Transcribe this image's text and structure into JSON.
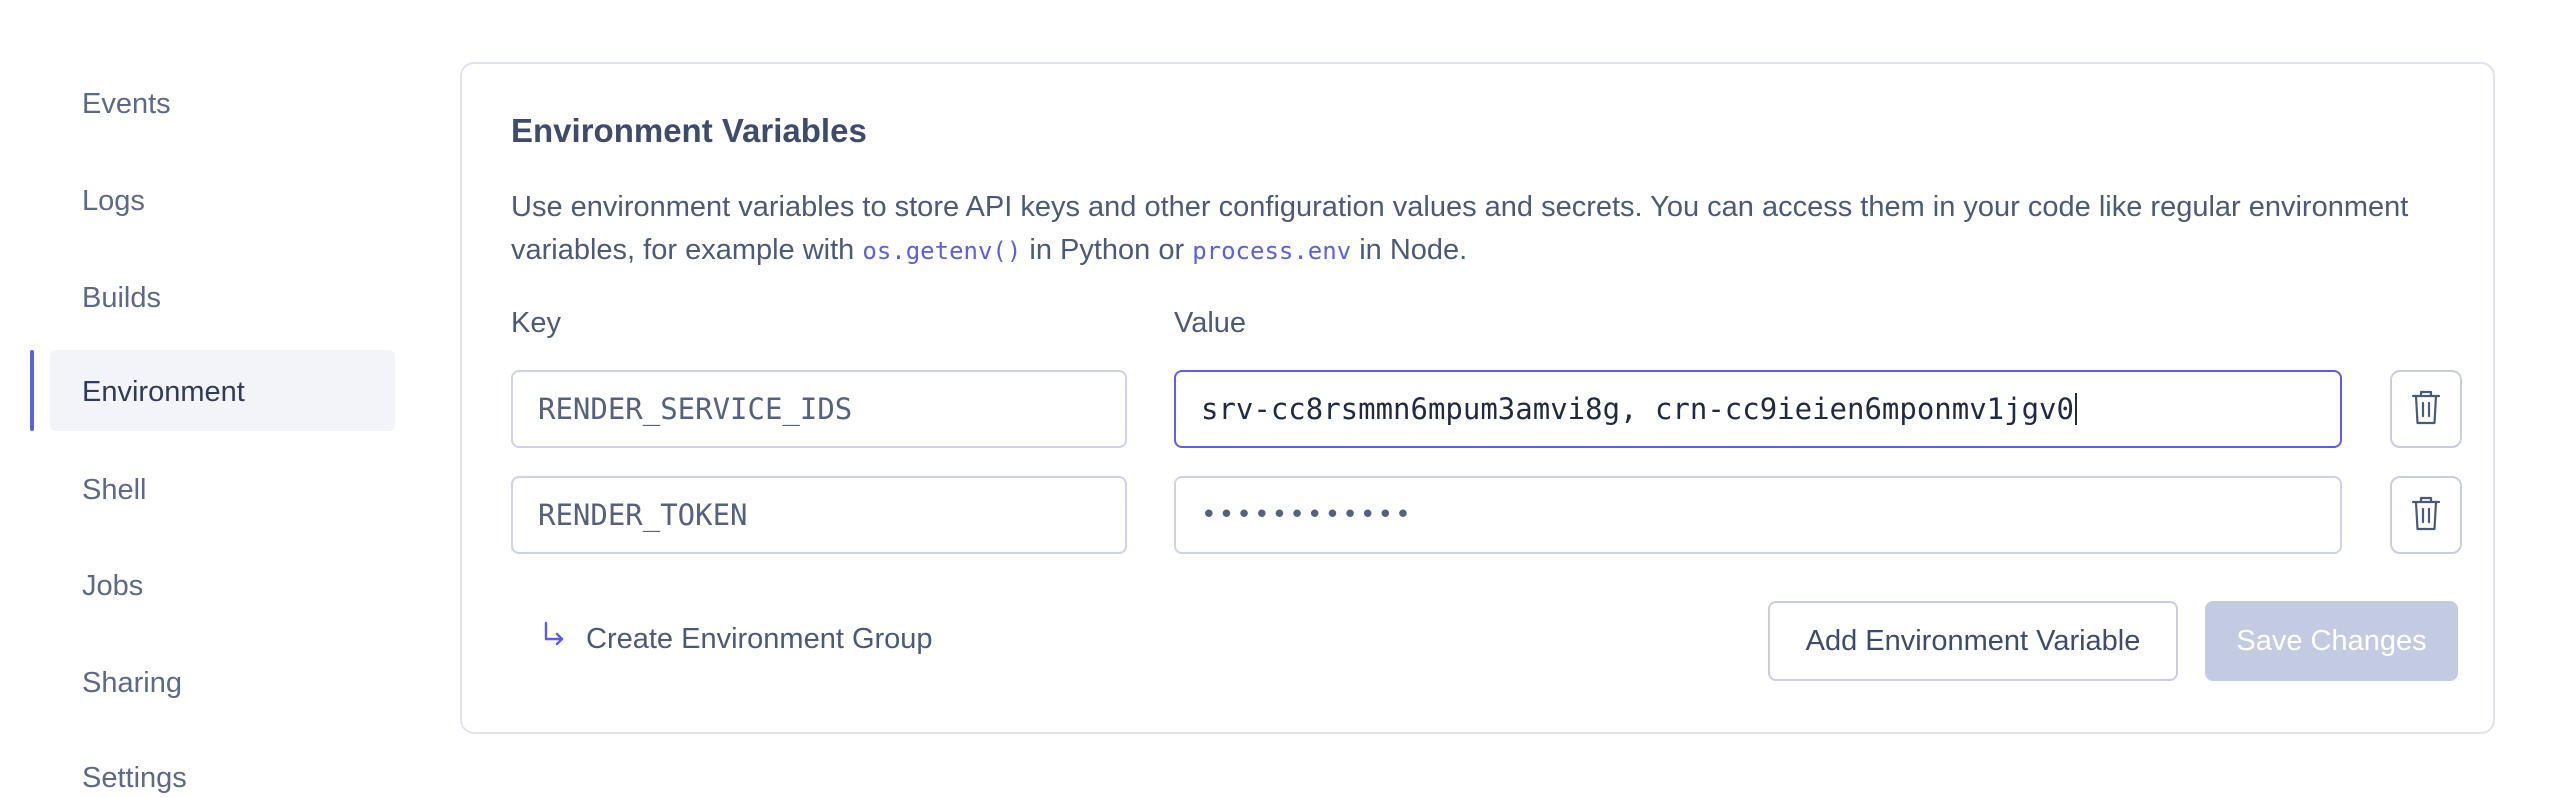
{
  "sidebar": {
    "items": [
      {
        "label": "Events"
      },
      {
        "label": "Logs"
      },
      {
        "label": "Builds"
      },
      {
        "label": "Environment"
      },
      {
        "label": "Shell"
      },
      {
        "label": "Jobs"
      },
      {
        "label": "Sharing"
      },
      {
        "label": "Settings"
      }
    ],
    "active": "Environment"
  },
  "env": {
    "title": "Environment Variables",
    "desc_part1": "Use environment variables to store API keys and other configuration values and secrets. You can access them in your code like regular environment variables, for example with ",
    "desc_code1": "os.getenv()",
    "desc_part2": " in Python or ",
    "desc_code2": "process.env",
    "desc_part3": " in Node.",
    "key_label": "Key",
    "value_label": "Value",
    "rows": [
      {
        "key": "RENDER_SERVICE_IDS",
        "value": "srv-cc8rsmmn6mpum3amvi8g, crn-cc9ieien6mponmv1jgv0"
      },
      {
        "key": "RENDER_TOKEN",
        "value": "••••••••••••"
      }
    ],
    "create_group_icon": "return-arrow-icon",
    "create_group_label": "Create Environment Group",
    "add_label": "Add Environment Variable",
    "save_label": "Save Changes"
  },
  "colors": {
    "accent": "#5b5fe6",
    "save_disabled": "#c3cbe2"
  }
}
